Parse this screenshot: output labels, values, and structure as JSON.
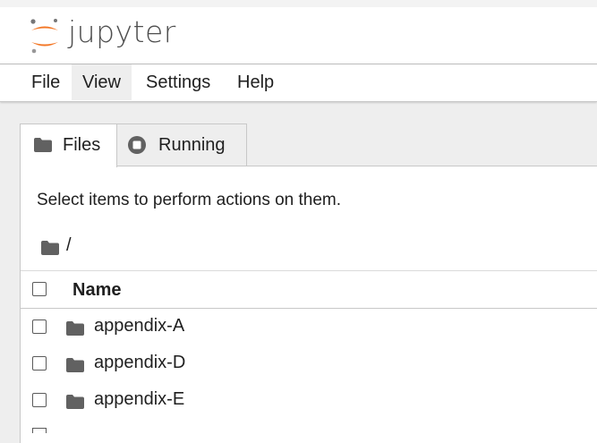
{
  "app": {
    "logo_text": "jupyter"
  },
  "menu": {
    "items": [
      "File",
      "View",
      "Settings",
      "Help"
    ],
    "active": "View"
  },
  "tabs": [
    {
      "label": "Files",
      "icon": "folder-icon",
      "active": true
    },
    {
      "label": "Running",
      "icon": "stop-circle-icon",
      "active": false
    }
  ],
  "browser": {
    "hint": "Select items to perform actions on them.",
    "breadcrumb": "/",
    "column_name": "Name",
    "files": [
      {
        "name": "appendix-A",
        "type": "folder"
      },
      {
        "name": "appendix-D",
        "type": "folder"
      },
      {
        "name": "appendix-E",
        "type": "folder"
      }
    ]
  },
  "colors": {
    "logo_orange": "#f37726",
    "icon_gray": "#616161",
    "background": "#eeeeee"
  }
}
